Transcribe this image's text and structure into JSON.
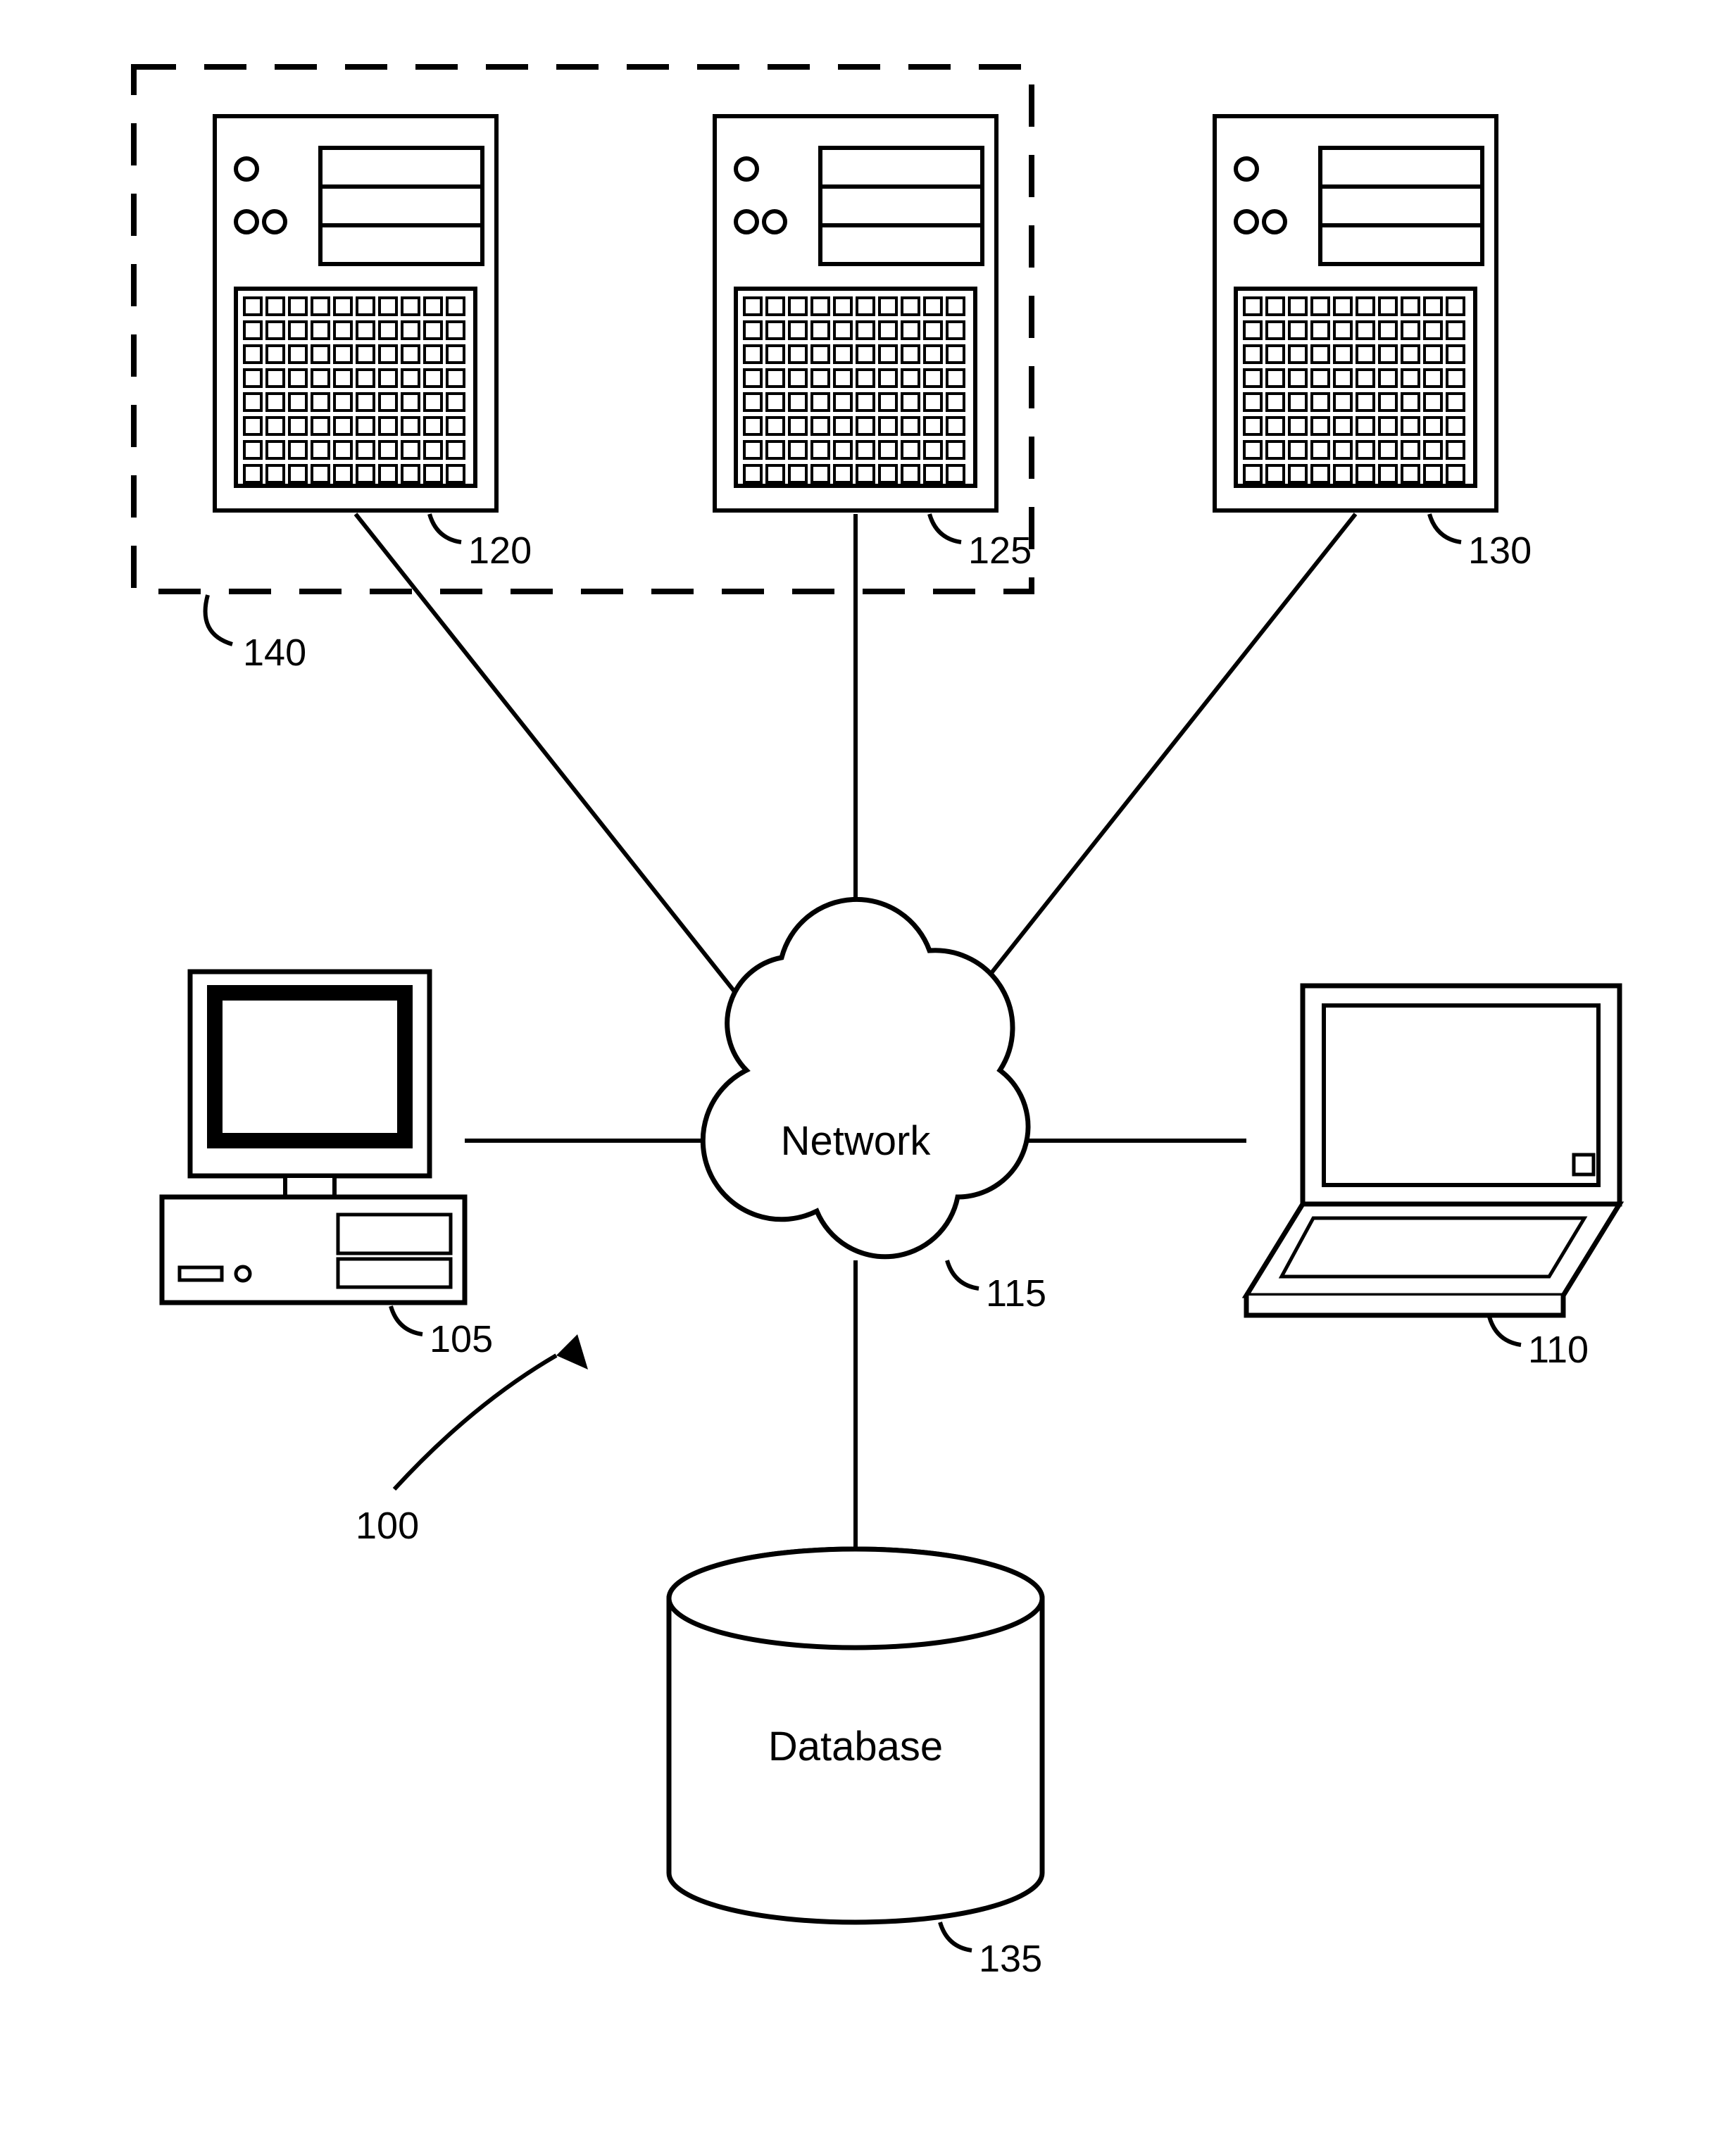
{
  "labels": {
    "network": "Network",
    "database": "Database",
    "ref100": "100",
    "ref105": "105",
    "ref110": "110",
    "ref115": "115",
    "ref120": "120",
    "ref125": "125",
    "ref130": "130",
    "ref135": "135",
    "ref140": "140"
  }
}
